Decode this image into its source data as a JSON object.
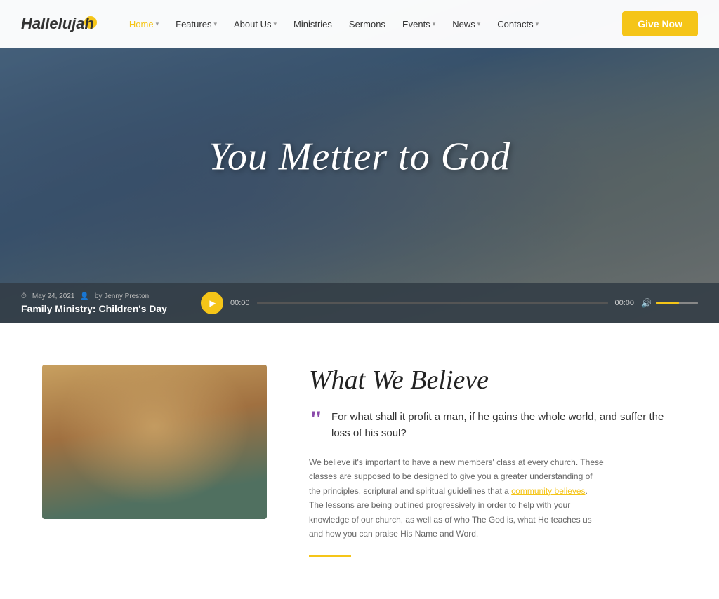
{
  "navbar": {
    "logo_text": "Hallelujah",
    "give_now_label": "Give Now",
    "nav_items": [
      {
        "label": "Home",
        "has_dropdown": true,
        "active": true
      },
      {
        "label": "Features",
        "has_dropdown": true,
        "active": false
      },
      {
        "label": "About Us",
        "has_dropdown": true,
        "active": false
      },
      {
        "label": "Ministries",
        "has_dropdown": false,
        "active": false
      },
      {
        "label": "Sermons",
        "has_dropdown": false,
        "active": false
      },
      {
        "label": "Events",
        "has_dropdown": true,
        "active": false
      },
      {
        "label": "News",
        "has_dropdown": true,
        "active": false
      },
      {
        "label": "Contacts",
        "has_dropdown": true,
        "active": false
      }
    ]
  },
  "hero": {
    "title": "You Metter to God",
    "audio": {
      "date": "May 24, 2021",
      "author": "by Jenny Preston",
      "sermon_title": "Family Ministry: Children's Day",
      "time_start": "00:00",
      "time_end": "00:00",
      "progress_percent": 0,
      "volume_percent": 55
    }
  },
  "lower": {
    "section_title": "What We Believe",
    "quote": "For what shall it profit a man, if he gains the whole world, and suffer the loss of his soul?",
    "body_text": "We believe it's important to have a new members' class at every church. These classes are supposed to be designed to give you a greater understanding of the principles, scriptural and spiritual guidelines that a community believes. The lessons are being outlined progressively in order to help with your knowledge of our church, as well as of who The God is, what He teaches us and how you can praise His Name and Word.",
    "link_text": "community believes"
  }
}
